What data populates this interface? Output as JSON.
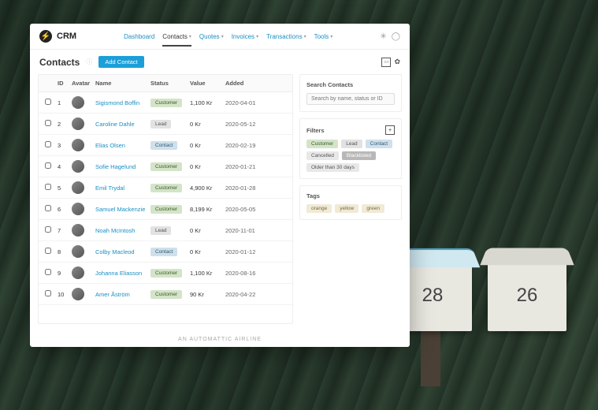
{
  "brand": "CRM",
  "nav": {
    "items": [
      "Dashboard",
      "Contacts",
      "Quotes",
      "Invoices",
      "Transactions",
      "Tools"
    ],
    "activeIndex": 1
  },
  "page": {
    "title": "Contacts",
    "addButton": "Add Contact"
  },
  "table": {
    "columns": [
      "",
      "ID",
      "Avatar",
      "Name",
      "Status",
      "Value",
      "Added"
    ],
    "rows": [
      {
        "id": 1,
        "name": "Sigismond Boffin",
        "status": "Customer",
        "status_class": "customer",
        "value": "1,100 Kr",
        "added": "2020-04-01"
      },
      {
        "id": 2,
        "name": "Caroline Dahle",
        "status": "Lead",
        "status_class": "lead",
        "value": "0 Kr",
        "added": "2020-05-12"
      },
      {
        "id": 3,
        "name": "Elias Olsen",
        "status": "Contact",
        "status_class": "contact",
        "value": "0 Kr",
        "added": "2020-02-19"
      },
      {
        "id": 4,
        "name": "Sofie Hagelund",
        "status": "Customer",
        "status_class": "customer",
        "value": "0 Kr",
        "added": "2020-01-21"
      },
      {
        "id": 5,
        "name": "Emil Trydal",
        "status": "Customer",
        "status_class": "customer",
        "value": "4,900 Kr",
        "added": "2020-01-28"
      },
      {
        "id": 6,
        "name": "Samuel Mackenzie",
        "status": "Customer",
        "status_class": "customer",
        "value": "8,199 Kr",
        "added": "2020-05-05"
      },
      {
        "id": 7,
        "name": "Noah McIntosh",
        "status": "Lead",
        "status_class": "lead",
        "value": "0 Kr",
        "added": "2020-11-01"
      },
      {
        "id": 8,
        "name": "Colby Macleod",
        "status": "Contact",
        "status_class": "contact",
        "value": "0 Kr",
        "added": "2020-01-12"
      },
      {
        "id": 9,
        "name": "Johanna Eliasson",
        "status": "Customer",
        "status_class": "customer",
        "value": "1,100 Kr",
        "added": "2020-08-16"
      },
      {
        "id": 10,
        "name": "Amer Åström",
        "status": "Customer",
        "status_class": "customer",
        "value": "90 Kr",
        "added": "2020-04-22"
      }
    ]
  },
  "search": {
    "title": "Search Contacts",
    "placeholder": "Search by name, status or ID"
  },
  "filters": {
    "title": "Filters",
    "items": [
      {
        "label": "Customer",
        "class": "customer"
      },
      {
        "label": "Lead",
        "class": "lead"
      },
      {
        "label": "Contact",
        "class": "contact"
      },
      {
        "label": "Cancelled",
        "class": "cancelled"
      },
      {
        "label": "Blacklisted",
        "class": "blacklisted"
      },
      {
        "label": "Older than 30 days",
        "class": "older"
      }
    ]
  },
  "tags": {
    "title": "Tags",
    "items": [
      "orange",
      "yellow",
      "green"
    ]
  },
  "footer": "AN AUTOMATTIC AIRLINE",
  "mailboxes": [
    "28",
    "26"
  ]
}
